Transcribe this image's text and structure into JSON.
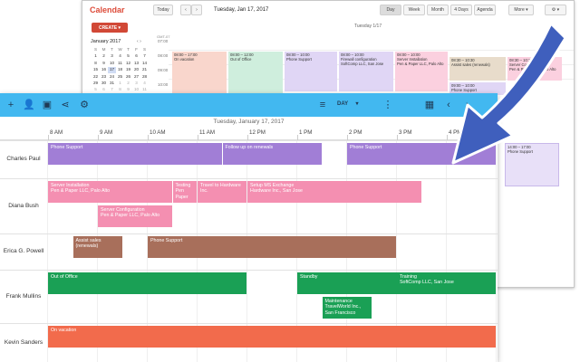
{
  "bg_calendar": {
    "app_title": "Calendar",
    "today_label": "Today",
    "date": "Tuesday, Jan 17, 2017",
    "views": [
      "Day",
      "Week",
      "Month",
      "4 Days",
      "Agenda"
    ],
    "more_label": "More",
    "create_label": "CREATE",
    "day_header": "Tuesday 1/17",
    "gmt_label": "GMT-07",
    "times": [
      "07:00",
      "08:00",
      "09:00",
      "10:00"
    ],
    "mini_month": "January 2017",
    "mini_days_header": [
      "S",
      "M",
      "T",
      "W",
      "T",
      "F",
      "S"
    ],
    "mini_days": [
      "1",
      "2",
      "3",
      "4",
      "5",
      "6",
      "7",
      "8",
      "9",
      "10",
      "11",
      "12",
      "13",
      "14",
      "15",
      "16",
      "17",
      "18",
      "19",
      "20",
      "21",
      "22",
      "23",
      "24",
      "25",
      "26",
      "27",
      "28",
      "29",
      "30",
      "31",
      "1",
      "2",
      "3",
      "4",
      "5",
      "6",
      "7",
      "8",
      "9",
      "10",
      "11"
    ],
    "events": [
      {
        "time": "08:00 – 17:00",
        "title": "On vacation"
      },
      {
        "time": "08:00 – 12:00",
        "title": "Out of Office"
      },
      {
        "time": "08:00 – 10:00",
        "title": "Phone Support"
      },
      {
        "time": "08:00 – 10:00",
        "title": "Firewall configuration",
        "sub": "SoftComp LLC, San Jose"
      },
      {
        "time": "08:00 – 10:00",
        "title": "Server Installation",
        "sub": "Pen & Paper LLC, Palo Alto"
      },
      {
        "time": "08:30 – 10:30",
        "title": "Assist sales (renewals)"
      },
      {
        "time": "08:30 – 10:30",
        "title": "Server Configuration",
        "sub": "Pen & Paper LLC, Palo Alto"
      },
      {
        "time": "09:00 – 10:00",
        "title": "Phone Support"
      },
      {
        "time": "14:00 – 17:00",
        "title": "Phone Support"
      }
    ]
  },
  "scheduler": {
    "toolbar": {
      "icons": [
        "add-icon",
        "add-person-icon",
        "save-icon",
        "share-icon",
        "settings-icon",
        "filter-icon",
        "dropdown-icon",
        "more-vert-icon",
        "calendar-icon",
        "prev-icon",
        "next-icon"
      ],
      "view_label": "DAY"
    },
    "date_header": "Tuesday, January 17, 2017",
    "hours": [
      "8 AM",
      "9 AM",
      "10 AM",
      "11 AM",
      "12 PM",
      "1 PM",
      "2 PM",
      "3 PM",
      "4 PM"
    ],
    "people": [
      "Charles Paul",
      "Diana Bush",
      "Erica G. Powell",
      "Frank Mullins",
      "Kevin Sanders"
    ],
    "events": [
      {
        "row": 0,
        "start": 8.0,
        "end": 11.5,
        "title": "Phone Support",
        "sub": "",
        "color": "#a17ed6"
      },
      {
        "row": 0,
        "start": 11.5,
        "end": 13.5,
        "title": "Follow up on renewals",
        "sub": "",
        "color": "#a17ed6"
      },
      {
        "row": 0,
        "start": 14.0,
        "end": 17.0,
        "title": "Phone Support",
        "sub": "",
        "color": "#a17ed6"
      },
      {
        "row": 1,
        "start": 8.0,
        "end": 10.5,
        "title": "Server Installation",
        "sub": "Pen & Paper LLC, Palo Alto",
        "color": "#f48fb1"
      },
      {
        "row": 1,
        "start": 10.5,
        "end": 11.0,
        "title": "Testing",
        "sub": "Pen Paper",
        "color": "#f48fb1"
      },
      {
        "row": 1,
        "start": 11.0,
        "end": 12.0,
        "title": "Travel to Hardware",
        "sub": "Inc.",
        "color": "#f48fb1"
      },
      {
        "row": 1,
        "start": 12.0,
        "end": 15.5,
        "title": "Setup MS Exchange",
        "sub": "Hardware Inc., San Jose",
        "color": "#f48fb1"
      },
      {
        "row": 1,
        "start": 9.0,
        "end": 10.5,
        "title": "Server Configuration",
        "sub": "Pen & Paper LLC, Palo Alto",
        "color": "#f48fb1"
      },
      {
        "row": 2,
        "start": 8.5,
        "end": 9.5,
        "title": "Assist sales",
        "sub": "(renewals)",
        "color": "#a86f5b"
      },
      {
        "row": 2,
        "start": 10.0,
        "end": 15.0,
        "title": "Phone Support",
        "sub": "",
        "color": "#a86f5b"
      },
      {
        "row": 3,
        "start": 8.0,
        "end": 12.0,
        "title": "Out of Office",
        "sub": "",
        "color": "#1aa055"
      },
      {
        "row": 3,
        "start": 13.0,
        "end": 17.0,
        "title": "Standby",
        "sub": "",
        "color": "#1aa055"
      },
      {
        "row": 3,
        "start": 13.5,
        "end": 14.5,
        "title": "Maintenance",
        "sub": "TravelWorld Inc., San Francisco",
        "color": "#1aa055"
      },
      {
        "row": 3,
        "start": 15.0,
        "end": 17.0,
        "title": "Training",
        "sub": "SoftComp LLC, San Jose",
        "color": "#1aa055"
      },
      {
        "row": 4,
        "start": 8.0,
        "end": 17.0,
        "title": "On vacation",
        "sub": "",
        "color": "#f26b4c"
      }
    ]
  }
}
